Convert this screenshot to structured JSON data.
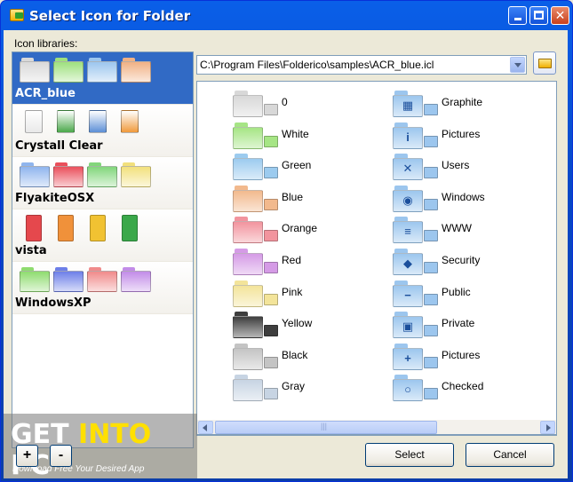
{
  "window": {
    "title": "Select Icon for Folder"
  },
  "libraries": {
    "label": "Icon libraries:",
    "items": [
      {
        "name": "ACR_blue",
        "selected": true,
        "preview": [
          "#d9d9d9",
          "#9ee07d",
          "#9cc6ee",
          "#f1b184"
        ]
      },
      {
        "name": "Crystall Clear",
        "selected": false,
        "preview": [
          "#e9e9e9",
          "#4aa84a",
          "#5c8fd6",
          "#f09a3c"
        ]
      },
      {
        "name": "FlyakiteOSX",
        "selected": false,
        "preview": [
          "#8fb5ee",
          "#ea4f5b",
          "#82d67b",
          "#f2e07c"
        ]
      },
      {
        "name": "vista",
        "selected": false,
        "preview": [
          "#e5484d",
          "#f0913a",
          "#f1c232",
          "#3aa84a"
        ]
      },
      {
        "name": "WindowsXP",
        "selected": false,
        "preview": [
          "#8fdc6f",
          "#6d7fe8",
          "#f08b8b",
          "#c28ce8"
        ]
      }
    ],
    "add_label": "+",
    "remove_label": "-"
  },
  "path": {
    "value": "C:\\Program Files\\Folderico\\samples\\ACR_blue.icl"
  },
  "icons": {
    "left": [
      {
        "label": "0",
        "color": "#d8d8d8"
      },
      {
        "label": "White",
        "color": "#a6e585"
      },
      {
        "label": "Green",
        "color": "#9ccbef"
      },
      {
        "label": "Blue",
        "color": "#f2b98d"
      },
      {
        "label": "Orange",
        "color": "#f2949e"
      },
      {
        "label": "Red",
        "color": "#d59be6"
      },
      {
        "label": "Pink",
        "color": "#f3e49a"
      },
      {
        "label": "Yellow",
        "color": "#3e3e3e"
      },
      {
        "label": "Black",
        "color": "#c4c4c4"
      },
      {
        "label": "Gray",
        "color": "#c7d4e3"
      }
    ],
    "right": [
      {
        "label": "Graphite",
        "color": "#9cc6ee",
        "glyph": "▦"
      },
      {
        "label": "Pictures",
        "color": "#9cc6ee",
        "glyph": "i"
      },
      {
        "label": "Users",
        "color": "#9cc6ee",
        "glyph": "✕"
      },
      {
        "label": "Windows",
        "color": "#9cc6ee",
        "glyph": "◉"
      },
      {
        "label": "WWW",
        "color": "#9cc6ee",
        "glyph": "≡"
      },
      {
        "label": "Security",
        "color": "#9cc6ee",
        "glyph": "◆"
      },
      {
        "label": "Public",
        "color": "#9cc6ee",
        "glyph": "−"
      },
      {
        "label": "Private",
        "color": "#9cc6ee",
        "glyph": "▣"
      },
      {
        "label": "Pictures",
        "color": "#9cc6ee",
        "glyph": "+"
      },
      {
        "label": "Checked",
        "color": "#9cc6ee",
        "glyph": "○"
      }
    ]
  },
  "buttons": {
    "select": "Select",
    "cancel": "Cancel"
  },
  "watermark": {
    "get": "GET ",
    "into": "INTO",
    "pc": " PC",
    "tagline": "Download Free Your Desired App"
  }
}
